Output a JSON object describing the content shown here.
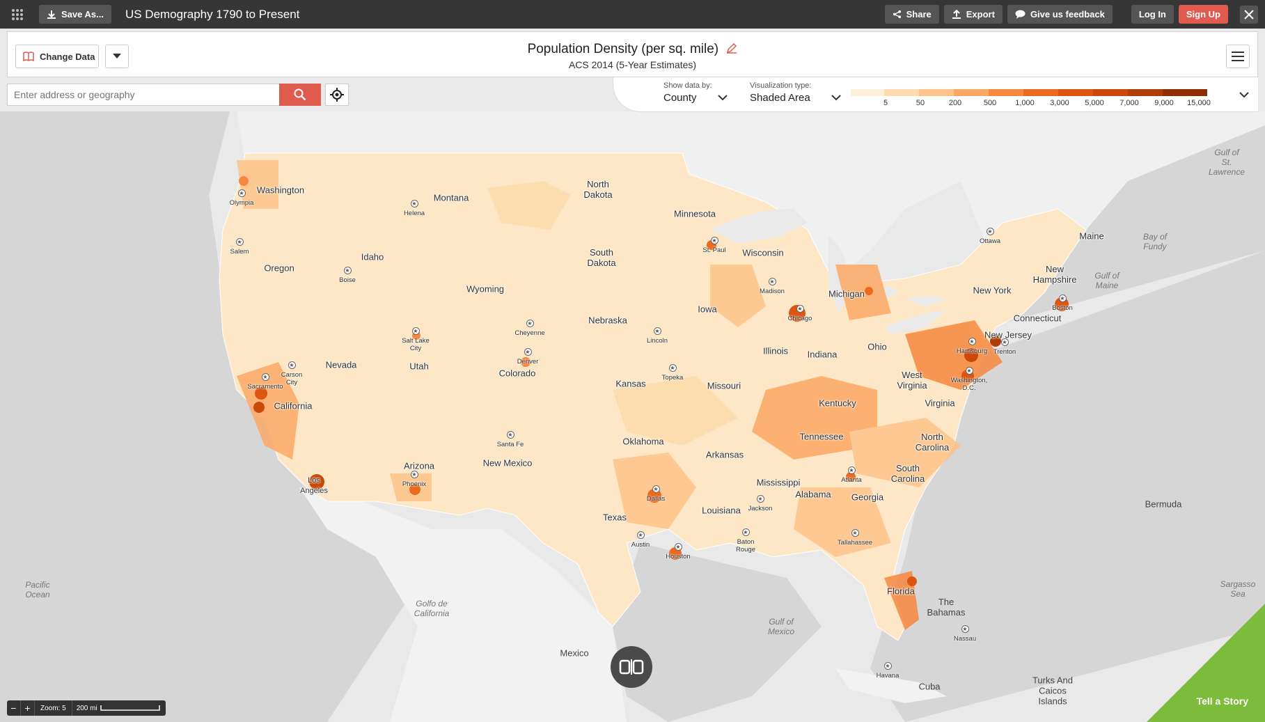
{
  "topbar": {
    "save_as": "Save As...",
    "title": "US Demography 1790 to Present",
    "share": "Share",
    "export": "Export",
    "feedback": "Give us feedback",
    "login": "Log In",
    "signup": "Sign Up"
  },
  "header": {
    "change_data": "Change Data",
    "title": "Population Density (per sq. mile)",
    "subtitle": "ACS 2014 (5-Year Estimates)"
  },
  "search": {
    "placeholder": "Enter address or geography"
  },
  "controls": {
    "show_data_by_label": "Show data by:",
    "show_data_by_value": "County",
    "viz_type_label": "Visualization type:",
    "viz_type_value": "Shaded Area"
  },
  "legend": {
    "colors": [
      "#fef0d9",
      "#fddbac",
      "#fdc38a",
      "#fca865",
      "#f7883f",
      "#ec6a1f",
      "#dd5511",
      "#c9480a",
      "#b03c06",
      "#8f2e02"
    ],
    "ticks": [
      "5",
      "50",
      "200",
      "500",
      "1,000",
      "3,000",
      "5,000",
      "7,000",
      "9,000",
      "15,000"
    ]
  },
  "map": {
    "states": [
      {
        "name": "Washington"
      },
      {
        "name": "Oregon"
      },
      {
        "name": "California"
      },
      {
        "name": "Idaho"
      },
      {
        "name": "Nevada"
      },
      {
        "name": "Montana"
      },
      {
        "name": "Wyoming"
      },
      {
        "name": "Utah"
      },
      {
        "name": "Arizona"
      },
      {
        "name": "Colorado"
      },
      {
        "name": "New Mexico"
      },
      {
        "name": "North\nDakota"
      },
      {
        "name": "South\nDakota"
      },
      {
        "name": "Nebraska"
      },
      {
        "name": "Kansas"
      },
      {
        "name": "Oklahoma"
      },
      {
        "name": "Texas"
      },
      {
        "name": "Minnesota"
      },
      {
        "name": "Iowa"
      },
      {
        "name": "Missouri"
      },
      {
        "name": "Arkansas"
      },
      {
        "name": "Louisiana"
      },
      {
        "name": "Wisconsin"
      },
      {
        "name": "Illinois"
      },
      {
        "name": "Michigan"
      },
      {
        "name": "Indiana"
      },
      {
        "name": "Ohio"
      },
      {
        "name": "Kentucky"
      },
      {
        "name": "Tennessee"
      },
      {
        "name": "Mississippi"
      },
      {
        "name": "Alabama"
      },
      {
        "name": "Georgia"
      },
      {
        "name": "Florida"
      },
      {
        "name": "South\nCarolina"
      },
      {
        "name": "North\nCarolina"
      },
      {
        "name": "Virginia"
      },
      {
        "name": "West\nVirginia"
      },
      {
        "name": "New York"
      },
      {
        "name": "New Jersey"
      },
      {
        "name": "Connecticut"
      },
      {
        "name": "New\nHampshire"
      },
      {
        "name": "Maine"
      }
    ],
    "cities": [
      {
        "name": "Olympia"
      },
      {
        "name": "Salem"
      },
      {
        "name": "Helena"
      },
      {
        "name": "Boise"
      },
      {
        "name": "Salt Lake\nCity"
      },
      {
        "name": "Cheyenne"
      },
      {
        "name": "Denver"
      },
      {
        "name": "Carson\nCity"
      },
      {
        "name": "Sacramento"
      },
      {
        "name": "Santa Fe"
      },
      {
        "name": "Phoenix"
      },
      {
        "name": "St. Paul"
      },
      {
        "name": "Lincoln"
      },
      {
        "name": "Topeka"
      },
      {
        "name": "Madison"
      },
      {
        "name": "Chicago"
      },
      {
        "name": "Dallas"
      },
      {
        "name": "Austin"
      },
      {
        "name": "Houston"
      },
      {
        "name": "Baton\nRouge"
      },
      {
        "name": "Jackson"
      },
      {
        "name": "Atlanta"
      },
      {
        "name": "Tallahassee"
      },
      {
        "name": "Harrisburg"
      },
      {
        "name": "Trenton"
      },
      {
        "name": "Washington,\nD.C."
      },
      {
        "name": "Boston"
      },
      {
        "name": "Ottawa"
      },
      {
        "name": "Nassau"
      },
      {
        "name": "Havana"
      }
    ],
    "big_city_labels": [
      {
        "name": "Los\nAngeles"
      }
    ],
    "water": [
      {
        "name": "Pacific\nOcean"
      },
      {
        "name": "Golfo de\nCalifornia"
      },
      {
        "name": "Gulf of\nMexico"
      },
      {
        "name": "Gulf of\nMaine"
      },
      {
        "name": "Bay of\nFundy"
      },
      {
        "name": "Gulf of\nSt.\nLawrence"
      },
      {
        "name": "Sargasso\nSea"
      }
    ],
    "countries": [
      {
        "name": "Mexico"
      },
      {
        "name": "Cuba"
      },
      {
        "name": "The\nBahamas"
      },
      {
        "name": "Bermuda"
      },
      {
        "name": "Turks And\nCaicos\nIslands"
      }
    ]
  },
  "bottom": {
    "zoom": "Zoom: 5",
    "scale": "200 mi",
    "tell_story": "Tell a Story"
  }
}
